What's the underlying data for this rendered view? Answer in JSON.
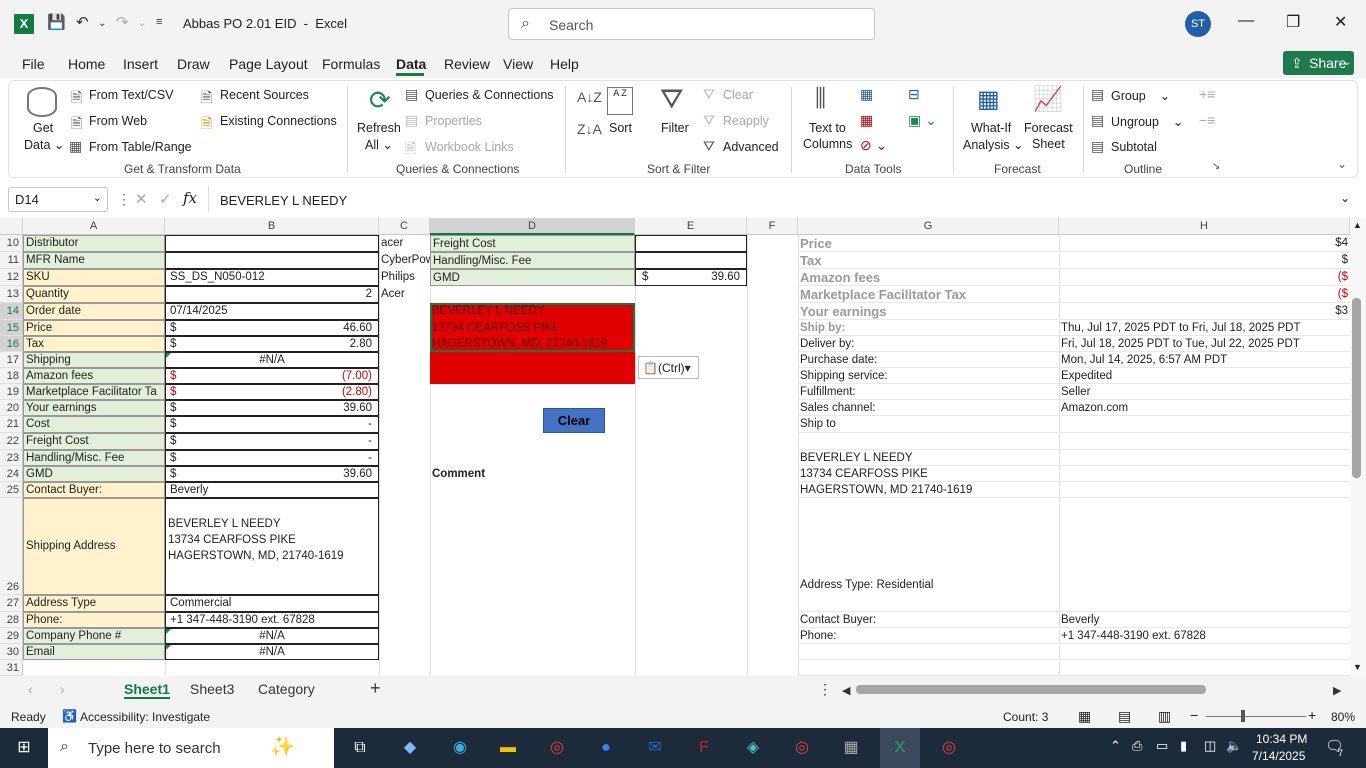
{
  "app": {
    "title": "Abbas PO 2.01 EID",
    "app_name": "Excel",
    "search_placeholder": "Search",
    "user_initials": "ST"
  },
  "menu": [
    "File",
    "Home",
    "Insert",
    "Draw",
    "Page Layout",
    "Formulas",
    "Data",
    "Review",
    "View",
    "Help"
  ],
  "share": "Share",
  "ribbon": {
    "get_data": "Get",
    "get_data2": "Data",
    "from_text": "From Text/CSV",
    "from_web": "From Web",
    "from_table": "From Table/Range",
    "recent": "Recent Sources",
    "existing": "Existing Connections",
    "group_get": "Get & Transform Data",
    "refresh": "Refresh",
    "refresh_all": "All",
    "queries": "Queries & Connections",
    "properties": "Properties",
    "workbook_links": "Workbook Links",
    "group_queries": "Queries & Connections",
    "sort": "Sort",
    "filter": "Filter",
    "clear": "Clear",
    "reapply": "Reapply",
    "advanced": "Advanced",
    "group_sort": "Sort & Filter",
    "text_to_columns": "Text to",
    "text_to_columns2": "Columns",
    "group_tools": "Data Tools",
    "whatif": "What-If",
    "whatif2": "Analysis",
    "forecast": "Forecast",
    "forecast2": "Sheet",
    "group_forecast": "Forecast",
    "group": "Group",
    "ungroup": "Ungroup",
    "subtotal": "Subtotal",
    "group_outline": "Outline"
  },
  "formula": {
    "namebox": "D14",
    "content": "BEVERLEY L NEEDY"
  },
  "columns": [
    "A",
    "B",
    "C",
    "D",
    "E",
    "F",
    "G",
    "H"
  ],
  "rows": [
    {
      "n": "10",
      "a": "Distributor",
      "b": "",
      "c": "acer",
      "d": "Freight Cost",
      "e": "",
      "g": "Price",
      "h": "$4"
    },
    {
      "n": "11",
      "a": "MFR Name",
      "b": "",
      "c": "CyberPow",
      "d": "Handling/Misc. Fee",
      "e": "",
      "g": "Tax",
      "h": "$"
    },
    {
      "n": "12",
      "a": "SKU",
      "b": "SS_DS_N050-012",
      "c": "Philips",
      "d": "GMD",
      "e": "$",
      "e2": "39.60",
      "g": "Amazon fees",
      "h": "($"
    },
    {
      "n": "13",
      "a": "Quantity",
      "b2": "2",
      "c": "Acer",
      "g": "Marketplace Facilitator Tax",
      "h": "($"
    },
    {
      "n": "14",
      "a": "Order date",
      "b": "07/14/2025",
      "d": "BEVERLEY L NEEDY",
      "g": "Your earnings",
      "h": "$3"
    },
    {
      "n": "15",
      "a": "Price",
      "b": "$",
      "b2": "46.60",
      "d": "13734 CEARFOSS PIKE",
      "g": "Ship by:",
      "h": "Thu, Jul 17, 2025 PDT to Fri, Jul 18, 2025 PDT"
    },
    {
      "n": "16",
      "a": "Tax",
      "b": "$",
      "b2": "2.80",
      "d": "HAGERSTOWN, MD, 21740-1619",
      "g": "Deliver by:",
      "h": "Fri, Jul 18, 2025 PDT to Tue, Jul 22, 2025 PDT"
    },
    {
      "n": "17",
      "a": "Shipping",
      "bc": "#N/A",
      "g": "Purchase date:",
      "h": "Mon, Jul 14, 2025, 6:57 AM PDT"
    },
    {
      "n": "18",
      "a": "Amazon fees",
      "b": "$",
      "b2": "(7.00)",
      "g": "Shipping service:",
      "h": "Expedited"
    },
    {
      "n": "19",
      "a": "Marketplace Facilitator Ta",
      "b": "$",
      "b2": "(2.80)",
      "g": "Fulfillment:",
      "h": "Seller"
    },
    {
      "n": "20",
      "a": "Your earnings",
      "b": "$",
      "b2": "39.60",
      "g": "Sales channel:",
      "h": "Amazon.com"
    },
    {
      "n": "21",
      "a": "Cost",
      "b": "$",
      "b2": "-",
      "g": "Ship to",
      "h": ""
    },
    {
      "n": "22",
      "a": "Freight Cost",
      "b": "$",
      "b2": "-",
      "g": "",
      "h": ""
    },
    {
      "n": "23",
      "a": "Handling/Misc. Fee",
      "b": "$",
      "b2": "-",
      "g": "BEVERLEY L NEEDY",
      "h": ""
    },
    {
      "n": "24",
      "a": "GMD",
      "b": "$",
      "b2": "39.60",
      "d": "Comment",
      "g": "13734 CEARFOSS PIKE",
      "h": ""
    },
    {
      "n": "25",
      "a": "Contact Buyer:",
      "b": "Beverly",
      "g": "HAGERSTOWN, MD 21740-1619",
      "h": ""
    }
  ],
  "row26": {
    "n": "26",
    "a": "Shipping Address",
    "b1": "BEVERLEY L NEEDY",
    "b2": "13734 CEARFOSS PIKE",
    "b3": "HAGERSTOWN, MD, 21740-1619",
    "g": "Address Type:  Residential"
  },
  "rows2": [
    {
      "n": "27",
      "a": "Address Type",
      "b": "Commercial",
      "g": "",
      "h": ""
    },
    {
      "n": "28",
      "a": "Phone:",
      "b": "+1 347-448-3190 ext. 67828",
      "g": "Contact Buyer:",
      "h": "Beverly"
    },
    {
      "n": "29",
      "a": "Company Phone #",
      "bc": "#N/A",
      "g": "Phone:",
      "h": "+1 347-448-3190 ext. 67828"
    },
    {
      "n": "30",
      "a": "Email",
      "bc": "#N/A",
      "g": "",
      "h": ""
    },
    {
      "n": "31",
      "a": "",
      "g": "",
      "h": ""
    }
  ],
  "clear_button": "Clear",
  "paste_ctrl": "(Ctrl)",
  "sheets": [
    "Sheet1",
    "Sheet3",
    "Category"
  ],
  "status": {
    "ready": "Ready",
    "accessibility": "Accessibility: Investigate",
    "count": "Count: 3",
    "zoom": "80%"
  },
  "taskbar": {
    "search": "Type here to search",
    "time": "10:34 PM",
    "date": "7/14/2025",
    "notif": "7"
  },
  "colors": {
    "excel_green": "#107c41",
    "red_fill": "#e00000",
    "header_yellow": "#fff2cc",
    "light_green": "#e2efda"
  }
}
